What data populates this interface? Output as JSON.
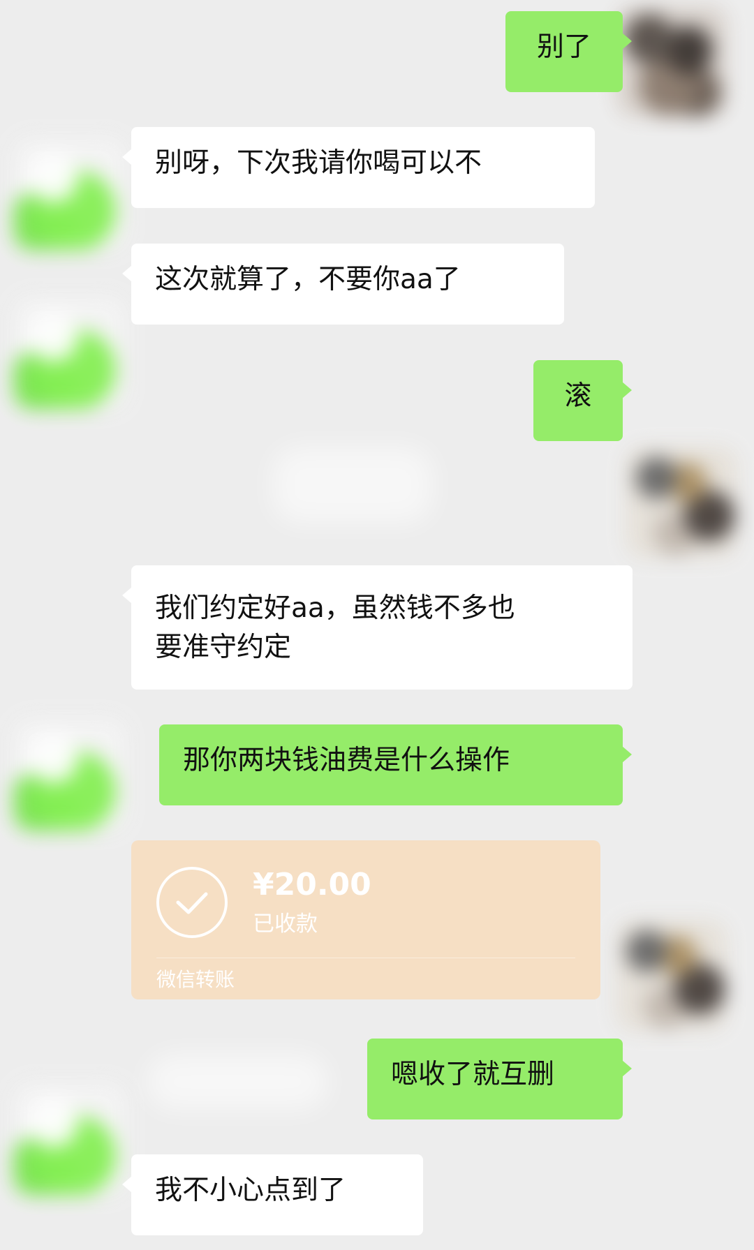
{
  "messages": [
    {
      "id": "m1",
      "side": "mine",
      "text": "别了"
    },
    {
      "id": "m2",
      "side": "other",
      "text": "别呀，下次我请你喝可以不"
    },
    {
      "id": "m3",
      "side": "other",
      "text": "这次就算了，不要你aa了"
    },
    {
      "id": "m4",
      "side": "mine",
      "text": "滚"
    },
    {
      "id": "m5",
      "side": "other",
      "text": "我们约定好aa，虽然钱不多也\n要准守约定"
    },
    {
      "id": "m6",
      "side": "mine",
      "text": "那你两块钱油费是什么操作"
    },
    {
      "id": "m8",
      "side": "mine",
      "text": "嗯收了就互删"
    },
    {
      "id": "m9",
      "side": "other",
      "text": "我不小心点到了"
    }
  ],
  "transfer": {
    "amount": "¥20.00",
    "status": "已收款",
    "label": "微信转账",
    "icon": "check-circle-icon"
  },
  "colors": {
    "background": "#ededed",
    "mine_bubble": "#95ec69",
    "other_bubble": "#ffffff",
    "transfer_card": "#f6dfc4"
  }
}
